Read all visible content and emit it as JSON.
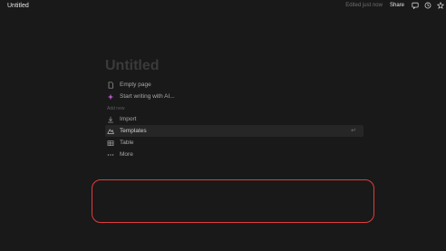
{
  "topbar": {
    "title": "Untitled",
    "edited": "Edited just now",
    "share_label": "Share",
    "icons": [
      "comment-icon",
      "clock-icon",
      "star-icon"
    ]
  },
  "main": {
    "title_placeholder": "Untitled",
    "quick_actions": [
      {
        "label": "Empty page",
        "icon": "page-icon"
      },
      {
        "label": "Start writing with AI...",
        "icon": "sparkle-icon"
      }
    ],
    "add_new_label": "Add new",
    "add_new_items": [
      {
        "label": "Import",
        "icon": "import-icon"
      },
      {
        "label": "Templates",
        "icon": "templates-icon",
        "hint": "↵"
      },
      {
        "label": "Table",
        "icon": "table-icon"
      },
      {
        "label": "More",
        "icon": "more-icon"
      }
    ]
  },
  "colors": {
    "background": "#191919",
    "highlight_box": "#e23b3b",
    "sparkle": "#c45cd6"
  }
}
